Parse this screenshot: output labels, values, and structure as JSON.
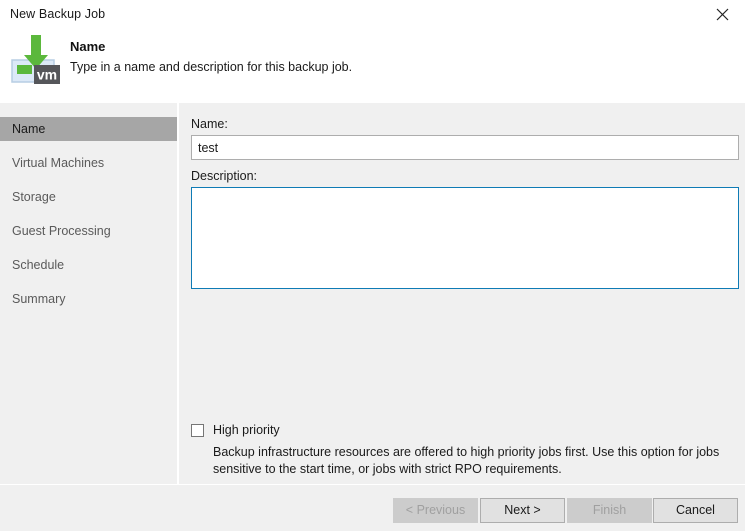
{
  "window": {
    "title": "New Backup Job",
    "close_icon": "close-icon"
  },
  "header": {
    "icon": "virtual-machine-backup-icon",
    "title": "Name",
    "subtitle": "Type in a name and description for this backup job."
  },
  "sidebar": {
    "items": [
      {
        "label": "Name",
        "selected": true
      },
      {
        "label": "Virtual Machines",
        "selected": false
      },
      {
        "label": "Storage",
        "selected": false
      },
      {
        "label": "Guest Processing",
        "selected": false
      },
      {
        "label": "Schedule",
        "selected": false
      },
      {
        "label": "Summary",
        "selected": false
      }
    ]
  },
  "main": {
    "name_label": "Name:",
    "name_value": "test",
    "name_placeholder": "",
    "description_label": "Description:",
    "description_value": "",
    "description_placeholder": "",
    "high_priority_label": "High priority",
    "high_priority_checked": false,
    "high_priority_hint": "Backup infrastructure resources are offered to high priority jobs first. Use this option for jobs sensitive to the start time, or jobs with strict RPO requirements."
  },
  "footer": {
    "previous_label": "< Previous",
    "previous_disabled": true,
    "next_label": "Next >",
    "next_disabled": false,
    "finish_label": "Finish",
    "finish_disabled": true,
    "cancel_label": "Cancel",
    "cancel_disabled": false
  },
  "colors": {
    "body_bg": "#f0f0f0",
    "selected_item_bg": "#a6a6a6",
    "focus_border": "#0f7bb5",
    "accent_green": "#5bb83c",
    "vm_badge": "#55565a"
  }
}
